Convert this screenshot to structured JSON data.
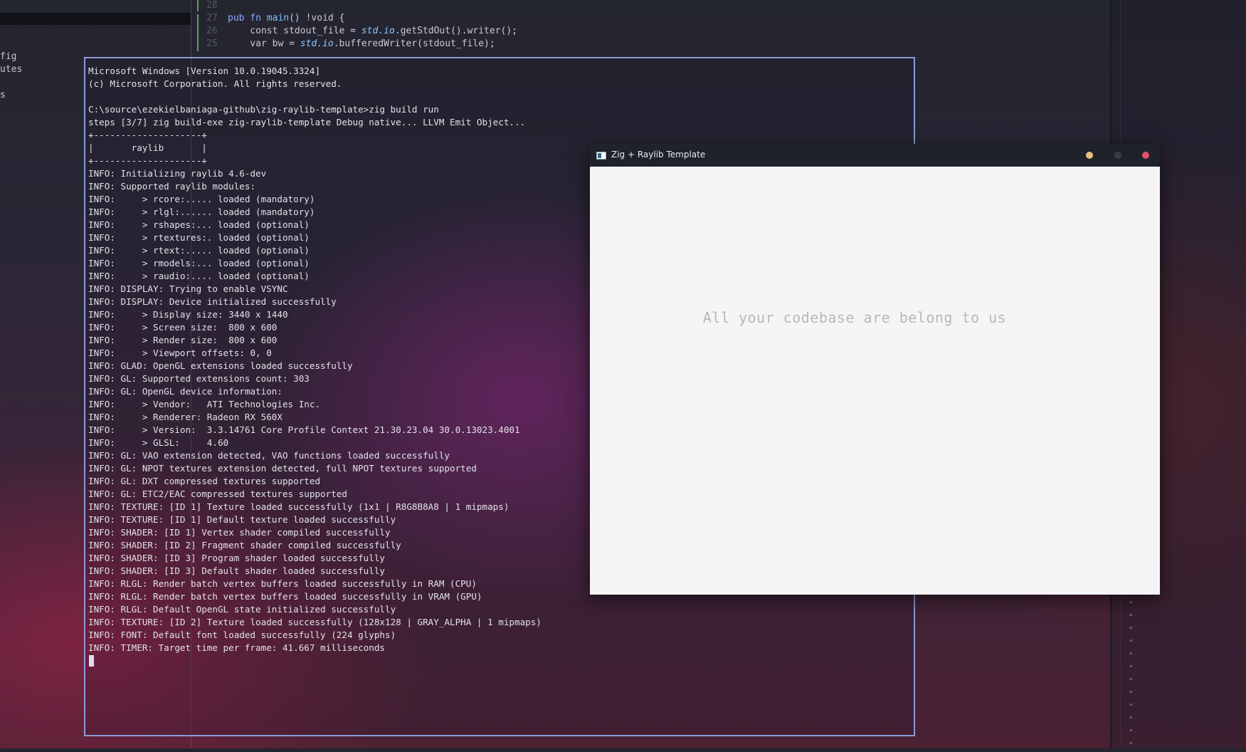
{
  "editor": {
    "sidebar_items": [
      "fig",
      "utes",
      "s"
    ],
    "code_lines": [
      {
        "num": "28",
        "code": ""
      },
      {
        "num": "27",
        "parts": [
          "pub fn ",
          "main",
          "() !void {"
        ]
      },
      {
        "num": "26",
        "parts": [
          "    const stdout_file = ",
          "std.io",
          ".getStdOut().writer();"
        ]
      },
      {
        "num": "25",
        "parts": [
          "    var bw = ",
          "std.io",
          ".bufferedWriter(stdout_file);"
        ]
      }
    ],
    "tick_glyphs": "\"\n\"\n\"\n\"\n\"\n\"\n\"\n\"\n\"\n\"\n\"\n\""
  },
  "terminal": {
    "lines": [
      "Microsoft Windows [Version 10.0.19045.3324]",
      "(c) Microsoft Corporation. All rights reserved.",
      "",
      "C:\\source\\ezekielbaniaga-github\\zig-raylib-template>zig build run",
      "steps [3/7] zig build-exe zig-raylib-template Debug native... LLVM Emit Object...",
      "+--------------------+",
      "|       raylib       |",
      "+--------------------+",
      "INFO: Initializing raylib 4.6-dev",
      "INFO: Supported raylib modules:",
      "INFO:     > rcore:..... loaded (mandatory)",
      "INFO:     > rlgl:...... loaded (mandatory)",
      "INFO:     > rshapes:... loaded (optional)",
      "INFO:     > rtextures:. loaded (optional)",
      "INFO:     > rtext:..... loaded (optional)",
      "INFO:     > rmodels:... loaded (optional)",
      "INFO:     > raudio:.... loaded (optional)",
      "INFO: DISPLAY: Trying to enable VSYNC",
      "INFO: DISPLAY: Device initialized successfully",
      "INFO:     > Display size: 3440 x 1440",
      "INFO:     > Screen size:  800 x 600",
      "INFO:     > Render size:  800 x 600",
      "INFO:     > Viewport offsets: 0, 0",
      "INFO: GLAD: OpenGL extensions loaded successfully",
      "INFO: GL: Supported extensions count: 303",
      "INFO: GL: OpenGL device information:",
      "INFO:     > Vendor:   ATI Technologies Inc.",
      "INFO:     > Renderer: Radeon RX 560X",
      "INFO:     > Version:  3.3.14761 Core Profile Context 21.30.23.04 30.0.13023.4001",
      "INFO:     > GLSL:     4.60",
      "INFO: GL: VAO extension detected, VAO functions loaded successfully",
      "INFO: GL: NPOT textures extension detected, full NPOT textures supported",
      "INFO: GL: DXT compressed textures supported",
      "INFO: GL: ETC2/EAC compressed textures supported",
      "INFO: TEXTURE: [ID 1] Texture loaded successfully (1x1 | R8G8B8A8 | 1 mipmaps)",
      "INFO: TEXTURE: [ID 1] Default texture loaded successfully",
      "INFO: SHADER: [ID 1] Vertex shader compiled successfully",
      "INFO: SHADER: [ID 2] Fragment shader compiled successfully",
      "INFO: SHADER: [ID 3] Program shader loaded successfully",
      "INFO: SHADER: [ID 3] Default shader loaded successfully",
      "INFO: RLGL: Render batch vertex buffers loaded successfully in RAM (CPU)",
      "INFO: RLGL: Render batch vertex buffers loaded successfully in VRAM (GPU)",
      "INFO: RLGL: Default OpenGL state initialized successfully",
      "INFO: TEXTURE: [ID 2] Texture loaded successfully (128x128 | GRAY_ALPHA | 1 mipmaps)",
      "INFO: FONT: Default font loaded successfully (224 glyphs)",
      "INFO: TIMER: Target time per frame: 41.667 milliseconds"
    ]
  },
  "raylib_window": {
    "title": "Zig + Raylib Template",
    "icon": "window-app-icon",
    "message": "All your codebase are belong to us",
    "canvas_color": "#f5f5f5",
    "controls": {
      "minimize_color": "#e8c37a",
      "maximize_color": "#3a3d48",
      "close_color": "#e0506a"
    }
  }
}
